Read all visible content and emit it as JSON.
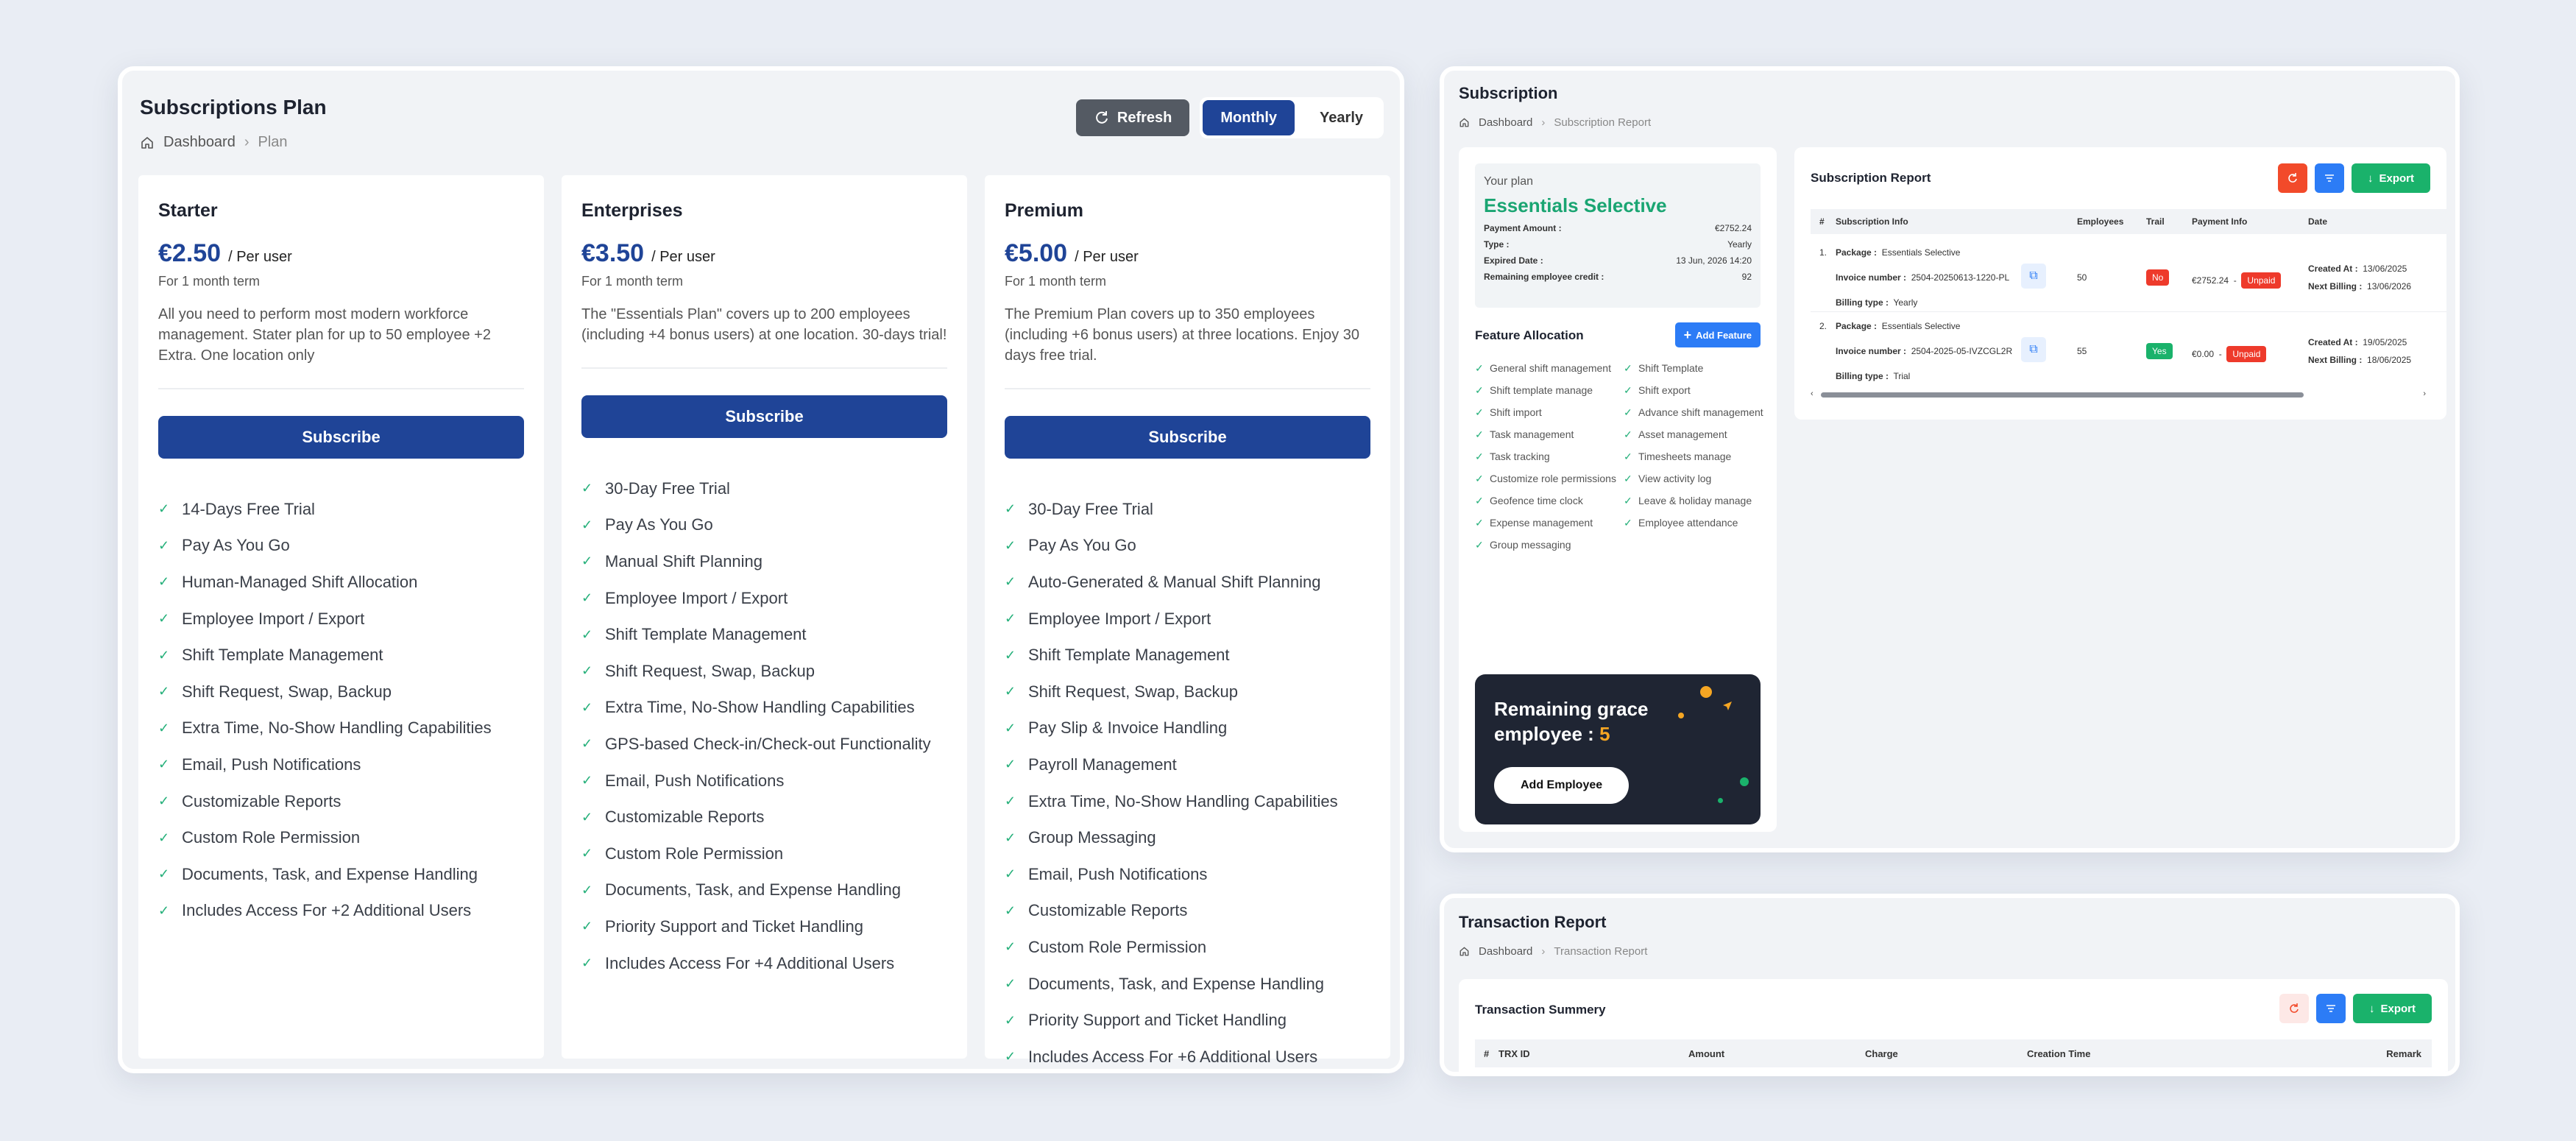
{
  "plans_page": {
    "title": "Subscriptions Plan",
    "breadcrumb": [
      "Dashboard",
      "Plan"
    ],
    "refresh_label": "Refresh",
    "billing_toggle": {
      "options": [
        "Monthly",
        "Yearly"
      ],
      "selected": "Monthly"
    },
    "plans": [
      {
        "name": "Starter",
        "price": "€2.50",
        "per": "/ Per user",
        "term": "For 1 month term",
        "description": "All you need to perform most modern workforce management. Stater plan for up to 50 employee +2 Extra. One location only",
        "subscribe_label": "Subscribe",
        "features": [
          "14-Days Free Trial",
          "Pay As You Go",
          "Human-Managed Shift Allocation",
          "Employee Import / Export",
          "Shift Template Management",
          "Shift Request, Swap, Backup",
          "Extra Time, No-Show Handling Capabilities",
          "Email, Push Notifications",
          "Customizable Reports",
          "Custom Role Permission",
          "Documents, Task, and Expense Handling",
          "Includes Access For +2 Additional Users"
        ]
      },
      {
        "name": "Enterprises",
        "price": "€3.50",
        "per": "/ Per user",
        "term": "For 1 month term",
        "description": "The \"Essentials Plan\" covers up to 200 employees (including +4 bonus users) at one location. 30-days trial!",
        "subscribe_label": "Subscribe",
        "features": [
          "30-Day Free Trial",
          "Pay As You Go",
          "Manual Shift Planning",
          "Employee Import / Export",
          "Shift Template Management",
          "Shift Request, Swap, Backup",
          "Extra Time, No-Show Handling Capabilities",
          "GPS-based Check-in/Check-out Functionality",
          "Email, Push Notifications",
          "Customizable Reports",
          "Custom Role Permission",
          "Documents, Task, and Expense Handling",
          "Priority Support and Ticket Handling",
          "Includes Access For +4 Additional Users"
        ]
      },
      {
        "name": "Premium",
        "price": "€5.00",
        "per": "/ Per user",
        "term": "For 1 month term",
        "description": "The Premium Plan covers up to 350 employees (including +6 bonus users) at three locations. Enjoy 30 days free trial.",
        "subscribe_label": "Subscribe",
        "features": [
          "30-Day Free Trial",
          "Pay As You Go",
          "Auto-Generated & Manual Shift Planning",
          "Employee Import / Export",
          "Shift Template Management",
          "Shift Request, Swap, Backup",
          "Pay Slip & Invoice Handling",
          "Payroll Management",
          "Extra Time, No-Show Handling Capabilities",
          "Group Messaging",
          "Email, Push Notifications",
          "Customizable Reports",
          "Custom Role Permission",
          "Documents, Task, and Expense Handling",
          "Priority Support and Ticket Handling",
          "Includes Access For +6 Additional Users"
        ]
      }
    ]
  },
  "subscription_page": {
    "title": "Subscription",
    "breadcrumb": [
      "Dashboard",
      "Subscription Report"
    ],
    "your_plan": {
      "label": "Your plan",
      "name": "Essentials Selective",
      "details": [
        {
          "k": "Payment Amount :",
          "v": "€2752.24"
        },
        {
          "k": "Type :",
          "v": "Yearly"
        },
        {
          "k": "Expired Date :",
          "v": "13 Jun, 2026 14:20"
        },
        {
          "k": "Remaining employee credit :",
          "v": "92"
        }
      ]
    },
    "feature_allocation": {
      "title": "Feature Allocation",
      "add_label": "Add Feature",
      "items": [
        "General shift management",
        "Shift Template",
        "Shift template manage",
        "Shift export",
        "Shift import",
        "Advance shift management",
        "Task management",
        "Asset management",
        "Task tracking",
        "Timesheets manage",
        "Customize role permissions",
        "View activity log",
        "Geofence time clock",
        "Leave & holiday manage",
        "Expense management",
        "Employee attendance",
        "Group messaging"
      ]
    },
    "grace": {
      "text": "Remaining grace employee : ",
      "count": "5",
      "button": "Add Employee"
    },
    "report": {
      "title": "Subscription Report",
      "export_label": "Export",
      "columns": [
        "#",
        "Subscription Info",
        "Employees",
        "Trail",
        "Payment Info",
        "Date"
      ],
      "rows": [
        {
          "index": "1.",
          "package_label": "Package :",
          "package": "Essentials Selective",
          "invoice_label": "Invoice number :",
          "invoice": "2504-20250613-1220-PL",
          "billing_label": "Billing type :",
          "billing": "Yearly",
          "employees": "50",
          "trail": "No",
          "amount": "€2752.24",
          "sep": "-",
          "status": "Unpaid",
          "created_label": "Created At :",
          "created": "13/06/2025",
          "next_label": "Next Billing :",
          "next": "13/06/2026"
        },
        {
          "index": "2.",
          "package_label": "Package :",
          "package": "Essentials Selective",
          "invoice_label": "Invoice number :",
          "invoice": "2504-2025-05-IVZCGL2R",
          "billing_label": "Billing type :",
          "billing": "Trial",
          "employees": "55",
          "trail": "Yes",
          "amount": "€0.00",
          "sep": "-",
          "status": "Unpaid",
          "created_label": "Created At :",
          "created": "19/05/2025",
          "next_label": "Next Billing :",
          "next": "18/06/2025"
        }
      ]
    }
  },
  "transaction_page": {
    "title": "Transaction Report",
    "breadcrumb": [
      "Dashboard",
      "Transaction Report"
    ],
    "summary_title": "Transaction Summery",
    "export_label": "Export",
    "columns": [
      "#",
      "TRX ID",
      "Amount",
      "Charge",
      "Creation Time",
      "Remark"
    ]
  },
  "colors": {
    "primary": "#1f4497",
    "success": "#1ab26b",
    "danger": "#f24a2a",
    "info": "#2c7cf6",
    "grace_bg": "#1f2533"
  }
}
